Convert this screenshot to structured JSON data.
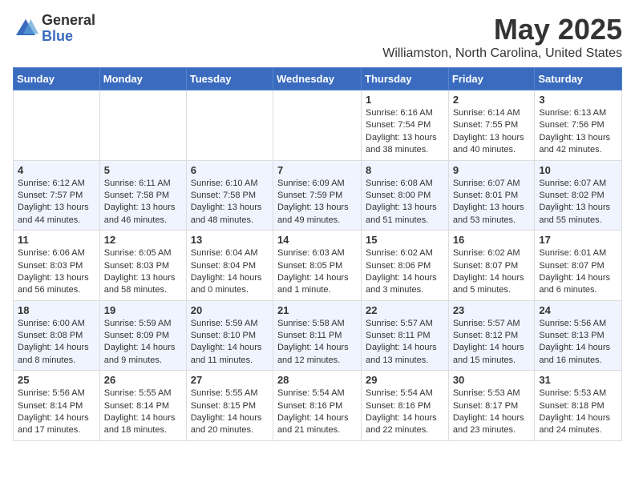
{
  "logo": {
    "general": "General",
    "blue": "Blue"
  },
  "title": {
    "month_year": "May 2025",
    "location": "Williamston, North Carolina, United States"
  },
  "headers": [
    "Sunday",
    "Monday",
    "Tuesday",
    "Wednesday",
    "Thursday",
    "Friday",
    "Saturday"
  ],
  "weeks": [
    [
      {
        "day": "",
        "content": ""
      },
      {
        "day": "",
        "content": ""
      },
      {
        "day": "",
        "content": ""
      },
      {
        "day": "",
        "content": ""
      },
      {
        "day": "1",
        "content": "Sunrise: 6:16 AM\nSunset: 7:54 PM\nDaylight: 13 hours\nand 38 minutes."
      },
      {
        "day": "2",
        "content": "Sunrise: 6:14 AM\nSunset: 7:55 PM\nDaylight: 13 hours\nand 40 minutes."
      },
      {
        "day": "3",
        "content": "Sunrise: 6:13 AM\nSunset: 7:56 PM\nDaylight: 13 hours\nand 42 minutes."
      }
    ],
    [
      {
        "day": "4",
        "content": "Sunrise: 6:12 AM\nSunset: 7:57 PM\nDaylight: 13 hours\nand 44 minutes."
      },
      {
        "day": "5",
        "content": "Sunrise: 6:11 AM\nSunset: 7:58 PM\nDaylight: 13 hours\nand 46 minutes."
      },
      {
        "day": "6",
        "content": "Sunrise: 6:10 AM\nSunset: 7:58 PM\nDaylight: 13 hours\nand 48 minutes."
      },
      {
        "day": "7",
        "content": "Sunrise: 6:09 AM\nSunset: 7:59 PM\nDaylight: 13 hours\nand 49 minutes."
      },
      {
        "day": "8",
        "content": "Sunrise: 6:08 AM\nSunset: 8:00 PM\nDaylight: 13 hours\nand 51 minutes."
      },
      {
        "day": "9",
        "content": "Sunrise: 6:07 AM\nSunset: 8:01 PM\nDaylight: 13 hours\nand 53 minutes."
      },
      {
        "day": "10",
        "content": "Sunrise: 6:07 AM\nSunset: 8:02 PM\nDaylight: 13 hours\nand 55 minutes."
      }
    ],
    [
      {
        "day": "11",
        "content": "Sunrise: 6:06 AM\nSunset: 8:03 PM\nDaylight: 13 hours\nand 56 minutes."
      },
      {
        "day": "12",
        "content": "Sunrise: 6:05 AM\nSunset: 8:03 PM\nDaylight: 13 hours\nand 58 minutes."
      },
      {
        "day": "13",
        "content": "Sunrise: 6:04 AM\nSunset: 8:04 PM\nDaylight: 14 hours\nand 0 minutes."
      },
      {
        "day": "14",
        "content": "Sunrise: 6:03 AM\nSunset: 8:05 PM\nDaylight: 14 hours\nand 1 minute."
      },
      {
        "day": "15",
        "content": "Sunrise: 6:02 AM\nSunset: 8:06 PM\nDaylight: 14 hours\nand 3 minutes."
      },
      {
        "day": "16",
        "content": "Sunrise: 6:02 AM\nSunset: 8:07 PM\nDaylight: 14 hours\nand 5 minutes."
      },
      {
        "day": "17",
        "content": "Sunrise: 6:01 AM\nSunset: 8:07 PM\nDaylight: 14 hours\nand 6 minutes."
      }
    ],
    [
      {
        "day": "18",
        "content": "Sunrise: 6:00 AM\nSunset: 8:08 PM\nDaylight: 14 hours\nand 8 minutes."
      },
      {
        "day": "19",
        "content": "Sunrise: 5:59 AM\nSunset: 8:09 PM\nDaylight: 14 hours\nand 9 minutes."
      },
      {
        "day": "20",
        "content": "Sunrise: 5:59 AM\nSunset: 8:10 PM\nDaylight: 14 hours\nand 11 minutes."
      },
      {
        "day": "21",
        "content": "Sunrise: 5:58 AM\nSunset: 8:11 PM\nDaylight: 14 hours\nand 12 minutes."
      },
      {
        "day": "22",
        "content": "Sunrise: 5:57 AM\nSunset: 8:11 PM\nDaylight: 14 hours\nand 13 minutes."
      },
      {
        "day": "23",
        "content": "Sunrise: 5:57 AM\nSunset: 8:12 PM\nDaylight: 14 hours\nand 15 minutes."
      },
      {
        "day": "24",
        "content": "Sunrise: 5:56 AM\nSunset: 8:13 PM\nDaylight: 14 hours\nand 16 minutes."
      }
    ],
    [
      {
        "day": "25",
        "content": "Sunrise: 5:56 AM\nSunset: 8:14 PM\nDaylight: 14 hours\nand 17 minutes."
      },
      {
        "day": "26",
        "content": "Sunrise: 5:55 AM\nSunset: 8:14 PM\nDaylight: 14 hours\nand 18 minutes."
      },
      {
        "day": "27",
        "content": "Sunrise: 5:55 AM\nSunset: 8:15 PM\nDaylight: 14 hours\nand 20 minutes."
      },
      {
        "day": "28",
        "content": "Sunrise: 5:54 AM\nSunset: 8:16 PM\nDaylight: 14 hours\nand 21 minutes."
      },
      {
        "day": "29",
        "content": "Sunrise: 5:54 AM\nSunset: 8:16 PM\nDaylight: 14 hours\nand 22 minutes."
      },
      {
        "day": "30",
        "content": "Sunrise: 5:53 AM\nSunset: 8:17 PM\nDaylight: 14 hours\nand 23 minutes."
      },
      {
        "day": "31",
        "content": "Sunrise: 5:53 AM\nSunset: 8:18 PM\nDaylight: 14 hours\nand 24 minutes."
      }
    ]
  ]
}
